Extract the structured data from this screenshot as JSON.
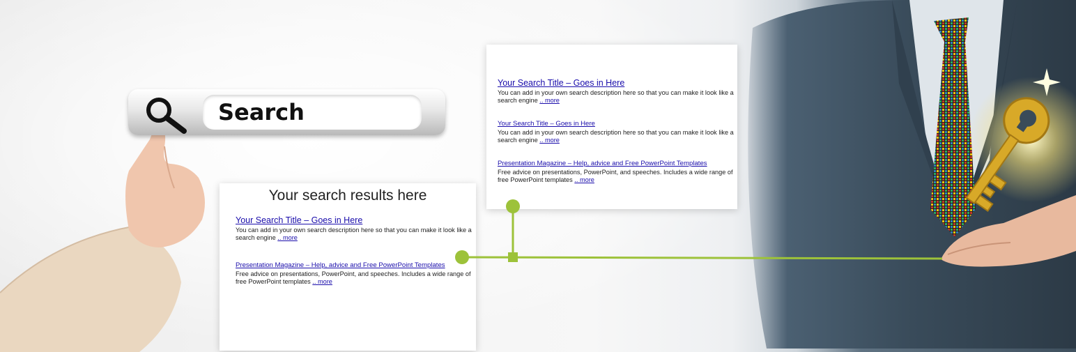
{
  "search": {
    "label": "Search"
  },
  "main_card": {
    "heading": "Your search results here",
    "results": [
      {
        "title": "Your Search Title – Goes in Here",
        "description": "You can add in your own search description here so that you can make it look like a search engine",
        "more": ".. more"
      },
      {
        "title": "Presentation Magazine – Help, advice and Free PowerPoint Templates",
        "description": "Free advice on presentations, PowerPoint, and speeches. Includes a wide range of free PowerPoint templates",
        "more": ".. more"
      }
    ]
  },
  "top_card": {
    "results": [
      {
        "title": "Your Search Title – Goes in Here",
        "description": "You can add in your own search description here so that you can make it look like a search engine",
        "more": ".. more"
      },
      {
        "title": "Your Search Title – Goes in Here",
        "description": "You can add in your own search description here so that you can make it look like a search engine",
        "more": ".. more"
      },
      {
        "title": "Presentation Magazine – Help, advice and Free PowerPoint Templates",
        "description": "Free advice on presentations, PowerPoint, and speeches. Includes a wide range of free PowerPoint templates",
        "more": ".. more"
      }
    ]
  },
  "colors": {
    "link": "#1a0dab",
    "accent_green": "#9dc23a",
    "suit": "#3b4d5c",
    "key_gold": "#d8a928"
  },
  "icons": [
    "magnifier-icon",
    "pointing-hand",
    "golden-key-icon"
  ]
}
